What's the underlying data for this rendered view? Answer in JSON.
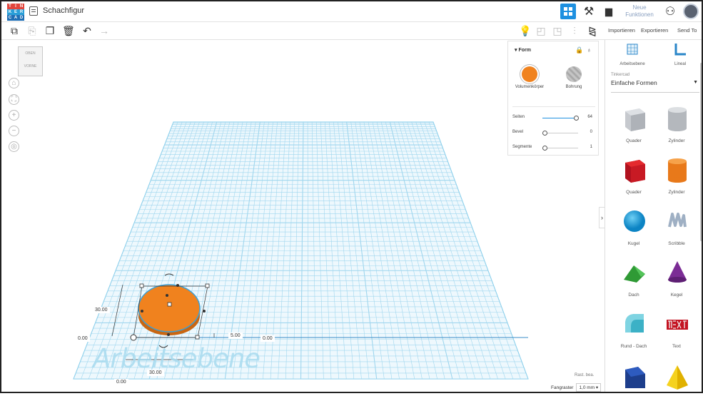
{
  "app": {
    "doc_title": "Schachfigur",
    "logo_letters": [
      "T",
      "I",
      "N",
      "K",
      "E",
      "R",
      "C",
      "A",
      "D"
    ],
    "new_features_label": "Neue Funktionen"
  },
  "toolbar": {
    "import_label": "Importieren",
    "export_label": "Exportieren",
    "send_label": "Send To"
  },
  "viewcube": {
    "top": "OBEN",
    "front": "VORNE"
  },
  "viewport": {
    "dim_height": "30.00",
    "dim_left_zero": "0.00",
    "dim_width": "30.00",
    "dim_bottom_zero": "0.00",
    "dim_elevation": "5.00",
    "dim_right_zero": "0.00",
    "workplane_text": "Arbeitsebene",
    "raster_label": "Rast. bea.",
    "snap_label": "Fangraster",
    "snap_value": "1,0 mm ▾"
  },
  "form_panel": {
    "title": "Form",
    "solid_label": "Volumenkörper",
    "hole_label": "Bohrung",
    "sliders": [
      {
        "label": "Seiten",
        "value": "64",
        "fraction": 1.0
      },
      {
        "label": "Bevel",
        "value": "0",
        "fraction": 0.0
      },
      {
        "label": "Segmente",
        "value": "1",
        "fraction": 0.0
      }
    ],
    "colors": {
      "solid": "#f0821e",
      "hole": "#b8b8b8"
    }
  },
  "sidebar": {
    "workplane_label": "Arbeitsebene",
    "ruler_label": "Lineal",
    "library_caption": "Tinkercad",
    "library_value": "Einfache Formen",
    "shapes": [
      {
        "label": "Quader"
      },
      {
        "label": "Zylinder"
      },
      {
        "label": "Quader"
      },
      {
        "label": "Zylinder"
      },
      {
        "label": "Kugel"
      },
      {
        "label": "Scribble"
      },
      {
        "label": "Dach"
      },
      {
        "label": "Kegel"
      },
      {
        "label": "Rund - Dach"
      },
      {
        "label": "Text"
      }
    ]
  },
  "colors": {
    "accent": "#1e90e0",
    "grid": "#79c8e8",
    "shape_orange": "#f0821e"
  }
}
